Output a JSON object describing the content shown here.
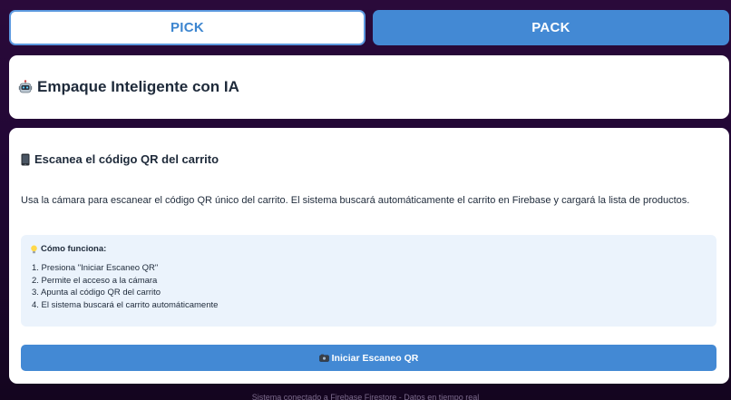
{
  "tabs": {
    "pick": "PICK",
    "pack": "PACK",
    "active": "PACK"
  },
  "header": {
    "icon": "robot-icon",
    "title": "Empaque Inteligente con IA"
  },
  "scanner": {
    "icon": "mobile-phone-icon",
    "title": "Escanea el código QR del carrito",
    "description": "Usa la cámara para escanear el código QR único del carrito. El sistema buscará automáticamente el carrito en Firebase y cargará la lista de productos.",
    "howto": {
      "icon": "lightbulb-icon",
      "title": "Cómo funciona:",
      "steps": [
        "1. Presiona \"Iniciar Escaneo QR\"",
        "2. Permite el acceso a la cámara",
        "3. Apunta al código QR del carrito",
        "4. El sistema buscará el carrito automáticamente"
      ]
    },
    "button": {
      "icon": "camera-icon",
      "label": "Iniciar Escaneo QR"
    }
  },
  "footer": {
    "text": "Sistema conectado a Firebase Firestore - Datos en tiempo real"
  },
  "colors": {
    "accent": "#4389d4",
    "info_bg": "#ebf3fc",
    "text": "#1e2a3a"
  }
}
